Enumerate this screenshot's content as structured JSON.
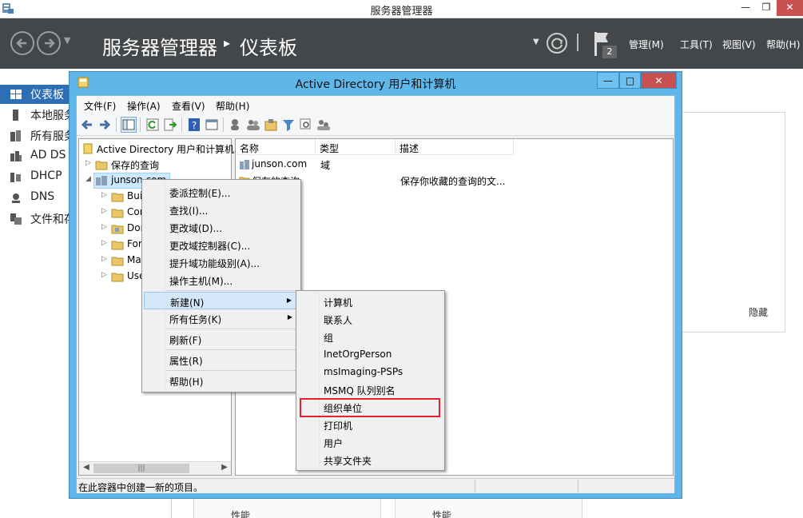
{
  "server_manager": {
    "window_title": "服务器管理器",
    "breadcrumb": [
      "服务器管理器",
      "仪表板"
    ],
    "flag_count": "2",
    "menus": {
      "manage": "管理(M)",
      "tools": "工具(T)",
      "view": "视图(V)",
      "help": "帮助(H)"
    },
    "sidebar": [
      {
        "label": "仪表板",
        "icon": "dashboard-icon",
        "active": true
      },
      {
        "label": "本地服务器",
        "icon": "server-icon"
      },
      {
        "label": "所有服务器",
        "icon": "servers-icon"
      },
      {
        "label": "AD DS",
        "icon": "ad-ds-icon"
      },
      {
        "label": "DHCP",
        "icon": "dhcp-icon"
      },
      {
        "label": "DNS",
        "icon": "dns-icon"
      },
      {
        "label": "文件和存储服务",
        "icon": "file-storage-icon"
      }
    ],
    "hide_label": "隐藏",
    "performance_labels": [
      "性能",
      "性能"
    ]
  },
  "aduc": {
    "title": "Active Directory 用户和计算机",
    "menu": {
      "file": "文件(F)",
      "action": "操作(A)",
      "view": "查看(V)",
      "help": "帮助(H)"
    },
    "tree": {
      "root": "Active Directory 用户和计算机",
      "saved_queries": "保存的查询",
      "domain": "junson.com",
      "children": [
        "Builtin",
        "Computers",
        "Domain Controllers",
        "ForeignSecurityPrincipals",
        "Managed Service Accounts",
        "Users"
      ]
    },
    "columns": {
      "name": "名称",
      "type": "类型",
      "description": "描述"
    },
    "rows": [
      {
        "name": "junson.com",
        "type": "域",
        "description": ""
      },
      {
        "name": "保存的查询",
        "type": "",
        "description": "保存你收藏的查询的文..."
      }
    ],
    "status": "在此容器中创建一新的项目。",
    "scroll_thumb": "|||"
  },
  "context_menu": {
    "items": [
      {
        "label": "委派控制(E)..."
      },
      {
        "label": "查找(I)..."
      },
      {
        "label": "更改域(D)..."
      },
      {
        "label": "更改域控制器(C)..."
      },
      {
        "label": "提升域功能级别(A)..."
      },
      {
        "label": "操作主机(M)..."
      },
      {
        "label": "新建(N)",
        "submenu": true,
        "highlighted": true
      },
      {
        "label": "所有任务(K)",
        "submenu": true
      },
      {
        "label": "刷新(F)"
      },
      {
        "label": "属性(R)"
      },
      {
        "label": "帮助(H)"
      }
    ]
  },
  "new_submenu": {
    "items": [
      "计算机",
      "联系人",
      "组",
      "InetOrgPerson",
      "msImaging-PSPs",
      "MSMQ 队列别名",
      "组织单位",
      "打印机",
      "用户",
      "共享文件夹"
    ],
    "annotated_item": "组织单位",
    "annotation_color": "#e8202a"
  },
  "colors": {
    "header_bg": "#444749",
    "sidebar_active": "#2e6eb5",
    "aduc_frame": "#5fb6e9",
    "close_red": "#c75050"
  }
}
